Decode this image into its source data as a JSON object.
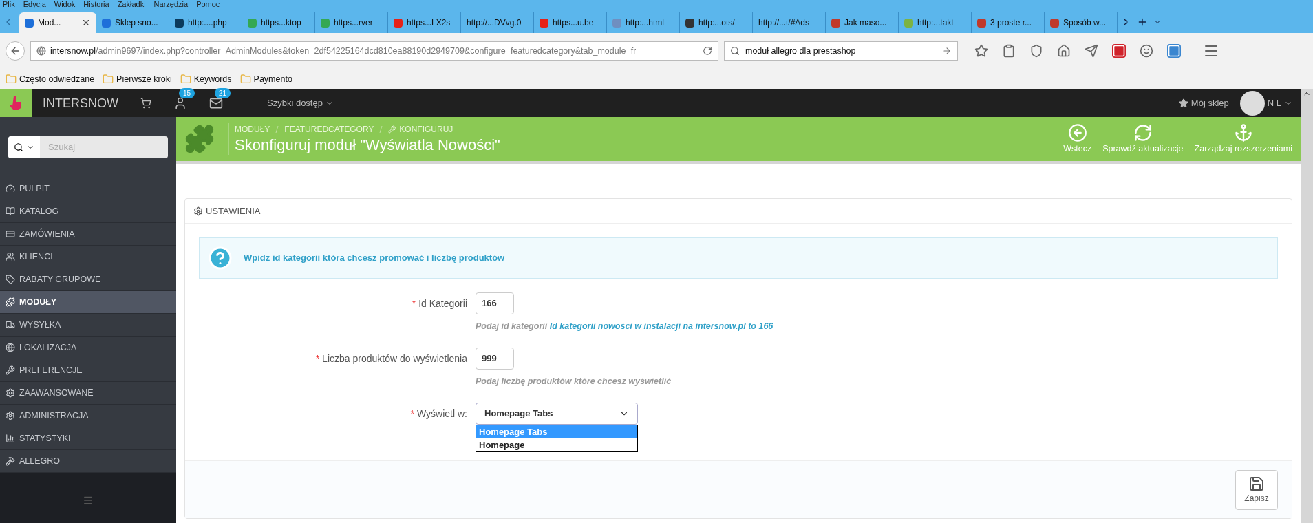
{
  "menu_bar": [
    "Plik",
    "Edycja",
    "Widok",
    "Historia",
    "Zakładki",
    "Narzędzia",
    "Pomoc"
  ],
  "tabs": [
    {
      "label": "Mod...",
      "selected": true,
      "color": "#1e6fd9"
    },
    {
      "label": "Sklep sno...",
      "selected": false,
      "color": "#1e6fd9"
    },
    {
      "label": "http:....php",
      "selected": false,
      "color": "#0b3a5c"
    },
    {
      "label": "https...ktop",
      "selected": false,
      "color": "#34a853"
    },
    {
      "label": "https...rver",
      "selected": false,
      "color": "#34a853"
    },
    {
      "label": "https...LX2s",
      "selected": false,
      "color": "#e62117"
    },
    {
      "label": "http://...DVvg.0",
      "selected": false
    },
    {
      "label": "https...u.be",
      "selected": false,
      "color": "#e62117"
    },
    {
      "label": "http:...html",
      "selected": false,
      "color": "#6f8fc0"
    },
    {
      "label": "http:...ots/",
      "selected": false,
      "color": "#333333"
    },
    {
      "label": "http://...t/#Ads",
      "selected": false
    },
    {
      "label": "Jak maso...",
      "selected": false,
      "color": "#c0392b"
    },
    {
      "label": "http:...takt",
      "selected": false,
      "color": "#7cb342"
    },
    {
      "label": "3 proste r...",
      "selected": false,
      "color": "#c0392b"
    },
    {
      "label": "Sposób w...",
      "selected": false,
      "color": "#c0392b"
    }
  ],
  "address": {
    "host": "intersnow.pl",
    "path": "/admin9697/index.php?controller=AdminModules&token=2df54225164dcd810ea88190d2949709&configure=featuredcategory&tab_module=fr"
  },
  "search": {
    "value": "moduł allegro dla prestashop"
  },
  "bookmarks": [
    "Często odwiedzane",
    "Pierwsze kroki",
    "Keywords",
    "Paymento"
  ],
  "topbar": {
    "brand": "INTERSNOW",
    "customers_badge": "15",
    "messages_badge": "21",
    "quick_access": "Szybki dostęp",
    "shop": "Mój sklep",
    "user": "N L"
  },
  "sidebar": {
    "search_placeholder": "Szukaj",
    "items": [
      {
        "label": "PULPIT",
        "selected": false
      },
      {
        "label": "KATALOG",
        "selected": false
      },
      {
        "label": "ZAMÓWIENIA",
        "selected": false
      },
      {
        "label": "KLIENCI",
        "selected": false
      },
      {
        "label": "RABATY GRUPOWE",
        "selected": false
      },
      {
        "label": "MODUŁY",
        "selected": true
      },
      {
        "label": "WYSYŁKA",
        "selected": false
      },
      {
        "label": "LOKALIZACJA",
        "selected": false
      },
      {
        "label": "PREFERENCJE",
        "selected": false
      },
      {
        "label": "ZAAWANSOWANE",
        "selected": false
      },
      {
        "label": "ADMINISTRACJA",
        "selected": false
      },
      {
        "label": "STATYSTYKI",
        "selected": false
      },
      {
        "label": "ALLEGRO",
        "selected": false
      }
    ]
  },
  "page_header": {
    "breadcrumb": [
      "MODUŁY",
      "FEATUREDCATEGORY",
      "KONFIGURUJ"
    ],
    "title": "Skonfiguruj moduł \"Wyświatla Nowości\"",
    "actions": [
      "Wstecz",
      "Sprawdź aktualizacje",
      "Zarządzaj rozszerzeniami"
    ]
  },
  "panel": {
    "heading": "USTAWIENIA",
    "alert": "Wpidz id kategorii która chcesz promować i liczbę produktów",
    "fields": [
      {
        "required_mark": "*",
        "label": "Id Kategorii",
        "kind": "text",
        "value": "166",
        "help": "Podaj id kategorii **Id kategorii nowości w instalacji na intersnow.pl to 166**"
      },
      {
        "required_mark": "*",
        "label": "Liczba produktów do wyświetlenia",
        "kind": "text",
        "value": "999",
        "help": "Podaj liczbę produktów które chcesz wyświetlić"
      },
      {
        "required_mark": "*",
        "label": "Wyświetl w:",
        "kind": "select",
        "value": "Homepage Tabs",
        "options": [
          {
            "label": "Homepage Tabs",
            "selected": true
          },
          {
            "label": "Homepage",
            "selected": false
          }
        ]
      }
    ],
    "save": "Zapisz"
  }
}
